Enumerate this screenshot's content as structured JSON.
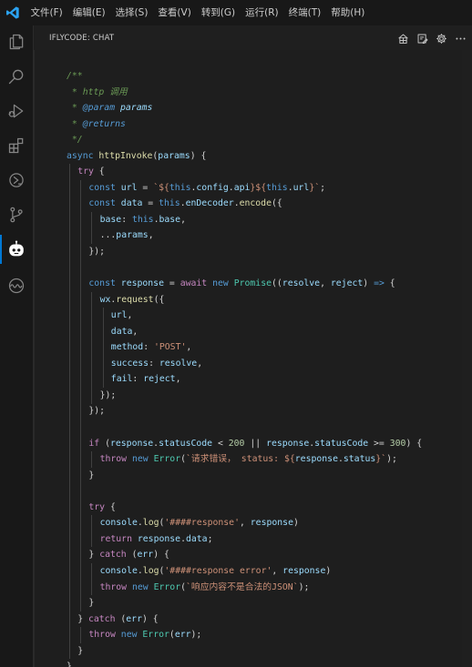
{
  "menu": {
    "items": [
      "文件(F)",
      "编辑(E)",
      "选择(S)",
      "查看(V)",
      "转到(G)",
      "运行(R)",
      "终端(T)",
      "帮助(H)"
    ],
    "more": "..."
  },
  "activity_bar": {
    "items": [
      {
        "name": "explorer-icon",
        "active": false
      },
      {
        "name": "search-icon",
        "active": false
      },
      {
        "name": "run-debug-icon",
        "active": false
      },
      {
        "name": "extensions-icon",
        "active": false
      },
      {
        "name": "remote-explorer-icon",
        "active": false
      },
      {
        "name": "source-control-icon",
        "active": false
      },
      {
        "name": "iflycode-robot-icon",
        "active": true
      },
      {
        "name": "wave-icon",
        "active": false
      }
    ]
  },
  "panel": {
    "title": "IFLYCODE: CHAT",
    "actions": [
      "home-icon",
      "edit-note-icon",
      "gear-icon",
      "more-icon"
    ]
  },
  "colors": {
    "accent": "#0078d4",
    "background": "#1e1e1e",
    "comment": "#6a9955",
    "keyword": "#569cd6",
    "control": "#c586c0",
    "function": "#dcdcaa",
    "variable": "#9cdcfe",
    "string": "#ce9178",
    "number": "#b5cea8",
    "class": "#4ec9b0"
  },
  "code": {
    "language": "javascript",
    "lines": [
      {
        "i": 0,
        "t": [
          [
            "cm",
            "/**"
          ]
        ]
      },
      {
        "i": 0,
        "t": [
          [
            "cm",
            " * http 调用"
          ]
        ]
      },
      {
        "i": 0,
        "t": [
          [
            "cm",
            " * "
          ],
          [
            "tag",
            "@param"
          ],
          [
            "cm",
            " "
          ],
          [
            "prm",
            "params"
          ]
        ]
      },
      {
        "i": 0,
        "t": [
          [
            "cm",
            " * "
          ],
          [
            "tag",
            "@returns"
          ]
        ]
      },
      {
        "i": 0,
        "t": [
          [
            "cm",
            " */"
          ]
        ]
      },
      {
        "i": 0,
        "t": [
          [
            "kw",
            "async"
          ],
          [
            "plain",
            " "
          ],
          [
            "fn",
            "httpInvoke"
          ],
          [
            "plain",
            "("
          ],
          [
            "var",
            "params"
          ],
          [
            "plain",
            ") {"
          ]
        ]
      },
      {
        "i": 1,
        "t": [
          [
            "ctl",
            "try"
          ],
          [
            "plain",
            " {"
          ]
        ]
      },
      {
        "i": 2,
        "t": [
          [
            "kw",
            "const"
          ],
          [
            "plain",
            " "
          ],
          [
            "var",
            "url"
          ],
          [
            "plain",
            " = "
          ],
          [
            "str",
            "`${"
          ],
          [
            "kw",
            "this"
          ],
          [
            "plain",
            "."
          ],
          [
            "var",
            "config"
          ],
          [
            "plain",
            "."
          ],
          [
            "var",
            "api"
          ],
          [
            "str",
            "}${"
          ],
          [
            "kw",
            "this"
          ],
          [
            "plain",
            "."
          ],
          [
            "var",
            "url"
          ],
          [
            "str",
            "}`"
          ],
          [
            "plain",
            ";"
          ]
        ]
      },
      {
        "i": 2,
        "t": [
          [
            "kw",
            "const"
          ],
          [
            "plain",
            " "
          ],
          [
            "var",
            "data"
          ],
          [
            "plain",
            " = "
          ],
          [
            "kw",
            "this"
          ],
          [
            "plain",
            "."
          ],
          [
            "var",
            "enDecoder"
          ],
          [
            "plain",
            "."
          ],
          [
            "fn",
            "encode"
          ],
          [
            "plain",
            "({"
          ]
        ]
      },
      {
        "i": 3,
        "t": [
          [
            "var",
            "base"
          ],
          [
            "plain",
            ": "
          ],
          [
            "kw",
            "this"
          ],
          [
            "plain",
            "."
          ],
          [
            "var",
            "base"
          ],
          [
            "plain",
            ","
          ]
        ]
      },
      {
        "i": 3,
        "t": [
          [
            "plain",
            "..."
          ],
          [
            "var",
            "params"
          ],
          [
            "plain",
            ","
          ]
        ]
      },
      {
        "i": 2,
        "t": [
          [
            "plain",
            "});"
          ]
        ]
      },
      {
        "i": 2,
        "t": []
      },
      {
        "i": 2,
        "t": [
          [
            "kw",
            "const"
          ],
          [
            "plain",
            " "
          ],
          [
            "var",
            "response"
          ],
          [
            "plain",
            " = "
          ],
          [
            "ctl",
            "await"
          ],
          [
            "plain",
            " "
          ],
          [
            "kw",
            "new"
          ],
          [
            "plain",
            " "
          ],
          [
            "cls",
            "Promise"
          ],
          [
            "plain",
            "(("
          ],
          [
            "var",
            "resolve"
          ],
          [
            "plain",
            ", "
          ],
          [
            "var",
            "reject"
          ],
          [
            "plain",
            ") "
          ],
          [
            "kw",
            "=>"
          ],
          [
            "plain",
            " {"
          ]
        ]
      },
      {
        "i": 3,
        "t": [
          [
            "var",
            "wx"
          ],
          [
            "plain",
            "."
          ],
          [
            "fn",
            "request"
          ],
          [
            "plain",
            "({"
          ]
        ]
      },
      {
        "i": 4,
        "t": [
          [
            "var",
            "url"
          ],
          [
            "plain",
            ","
          ]
        ]
      },
      {
        "i": 4,
        "t": [
          [
            "var",
            "data"
          ],
          [
            "plain",
            ","
          ]
        ]
      },
      {
        "i": 4,
        "t": [
          [
            "var",
            "method"
          ],
          [
            "plain",
            ": "
          ],
          [
            "str",
            "'POST'"
          ],
          [
            "plain",
            ","
          ]
        ]
      },
      {
        "i": 4,
        "t": [
          [
            "var",
            "success"
          ],
          [
            "plain",
            ": "
          ],
          [
            "var",
            "resolve"
          ],
          [
            "plain",
            ","
          ]
        ]
      },
      {
        "i": 4,
        "t": [
          [
            "var",
            "fail"
          ],
          [
            "plain",
            ": "
          ],
          [
            "var",
            "reject"
          ],
          [
            "plain",
            ","
          ]
        ]
      },
      {
        "i": 3,
        "t": [
          [
            "plain",
            "});"
          ]
        ]
      },
      {
        "i": 2,
        "t": [
          [
            "plain",
            "});"
          ]
        ]
      },
      {
        "i": 2,
        "t": []
      },
      {
        "i": 2,
        "t": [
          [
            "ctl",
            "if"
          ],
          [
            "plain",
            " ("
          ],
          [
            "var",
            "response"
          ],
          [
            "plain",
            "."
          ],
          [
            "var",
            "statusCode"
          ],
          [
            "plain",
            " < "
          ],
          [
            "num",
            "200"
          ],
          [
            "plain",
            " || "
          ],
          [
            "var",
            "response"
          ],
          [
            "plain",
            "."
          ],
          [
            "var",
            "statusCode"
          ],
          [
            "plain",
            " >= "
          ],
          [
            "num",
            "300"
          ],
          [
            "plain",
            ") {"
          ]
        ]
      },
      {
        "i": 3,
        "t": [
          [
            "ctl",
            "throw"
          ],
          [
            "plain",
            " "
          ],
          [
            "kw",
            "new"
          ],
          [
            "plain",
            " "
          ],
          [
            "cls",
            "Error"
          ],
          [
            "plain",
            "("
          ],
          [
            "str",
            "`请求错误， status: ${"
          ],
          [
            "var",
            "response"
          ],
          [
            "plain",
            "."
          ],
          [
            "var",
            "status"
          ],
          [
            "str",
            "}`"
          ],
          [
            "plain",
            ");"
          ]
        ]
      },
      {
        "i": 2,
        "t": [
          [
            "plain",
            "}"
          ]
        ]
      },
      {
        "i": 2,
        "t": []
      },
      {
        "i": 2,
        "t": [
          [
            "ctl",
            "try"
          ],
          [
            "plain",
            " {"
          ]
        ]
      },
      {
        "i": 3,
        "t": [
          [
            "var",
            "console"
          ],
          [
            "plain",
            "."
          ],
          [
            "fn",
            "log"
          ],
          [
            "plain",
            "("
          ],
          [
            "str",
            "'####response'"
          ],
          [
            "plain",
            ", "
          ],
          [
            "var",
            "response"
          ],
          [
            "plain",
            ")"
          ]
        ]
      },
      {
        "i": 3,
        "t": [
          [
            "ctl",
            "return"
          ],
          [
            "plain",
            " "
          ],
          [
            "var",
            "response"
          ],
          [
            "plain",
            "."
          ],
          [
            "var",
            "data"
          ],
          [
            "plain",
            ";"
          ]
        ]
      },
      {
        "i": 2,
        "t": [
          [
            "plain",
            "} "
          ],
          [
            "ctl",
            "catch"
          ],
          [
            "plain",
            " ("
          ],
          [
            "var",
            "err"
          ],
          [
            "plain",
            ") {"
          ]
        ]
      },
      {
        "i": 3,
        "t": [
          [
            "var",
            "console"
          ],
          [
            "plain",
            "."
          ],
          [
            "fn",
            "log"
          ],
          [
            "plain",
            "("
          ],
          [
            "str",
            "'####response error'"
          ],
          [
            "plain",
            ", "
          ],
          [
            "var",
            "response"
          ],
          [
            "plain",
            ")"
          ]
        ]
      },
      {
        "i": 3,
        "t": [
          [
            "ctl",
            "throw"
          ],
          [
            "plain",
            " "
          ],
          [
            "kw",
            "new"
          ],
          [
            "plain",
            " "
          ],
          [
            "cls",
            "Error"
          ],
          [
            "plain",
            "("
          ],
          [
            "str",
            "`响应内容不是合法的JSON`"
          ],
          [
            "plain",
            ");"
          ]
        ]
      },
      {
        "i": 2,
        "t": [
          [
            "plain",
            "}"
          ]
        ]
      },
      {
        "i": 1,
        "t": [
          [
            "plain",
            "} "
          ],
          [
            "ctl",
            "catch"
          ],
          [
            "plain",
            " ("
          ],
          [
            "var",
            "err"
          ],
          [
            "plain",
            ") {"
          ]
        ]
      },
      {
        "i": 2,
        "t": [
          [
            "ctl",
            "throw"
          ],
          [
            "plain",
            " "
          ],
          [
            "kw",
            "new"
          ],
          [
            "plain",
            " "
          ],
          [
            "cls",
            "Error"
          ],
          [
            "plain",
            "("
          ],
          [
            "var",
            "err"
          ],
          [
            "plain",
            ");"
          ]
        ]
      },
      {
        "i": 1,
        "t": [
          [
            "plain",
            "}"
          ]
        ]
      },
      {
        "i": 0,
        "t": [
          [
            "plain",
            "}"
          ]
        ]
      }
    ]
  }
}
